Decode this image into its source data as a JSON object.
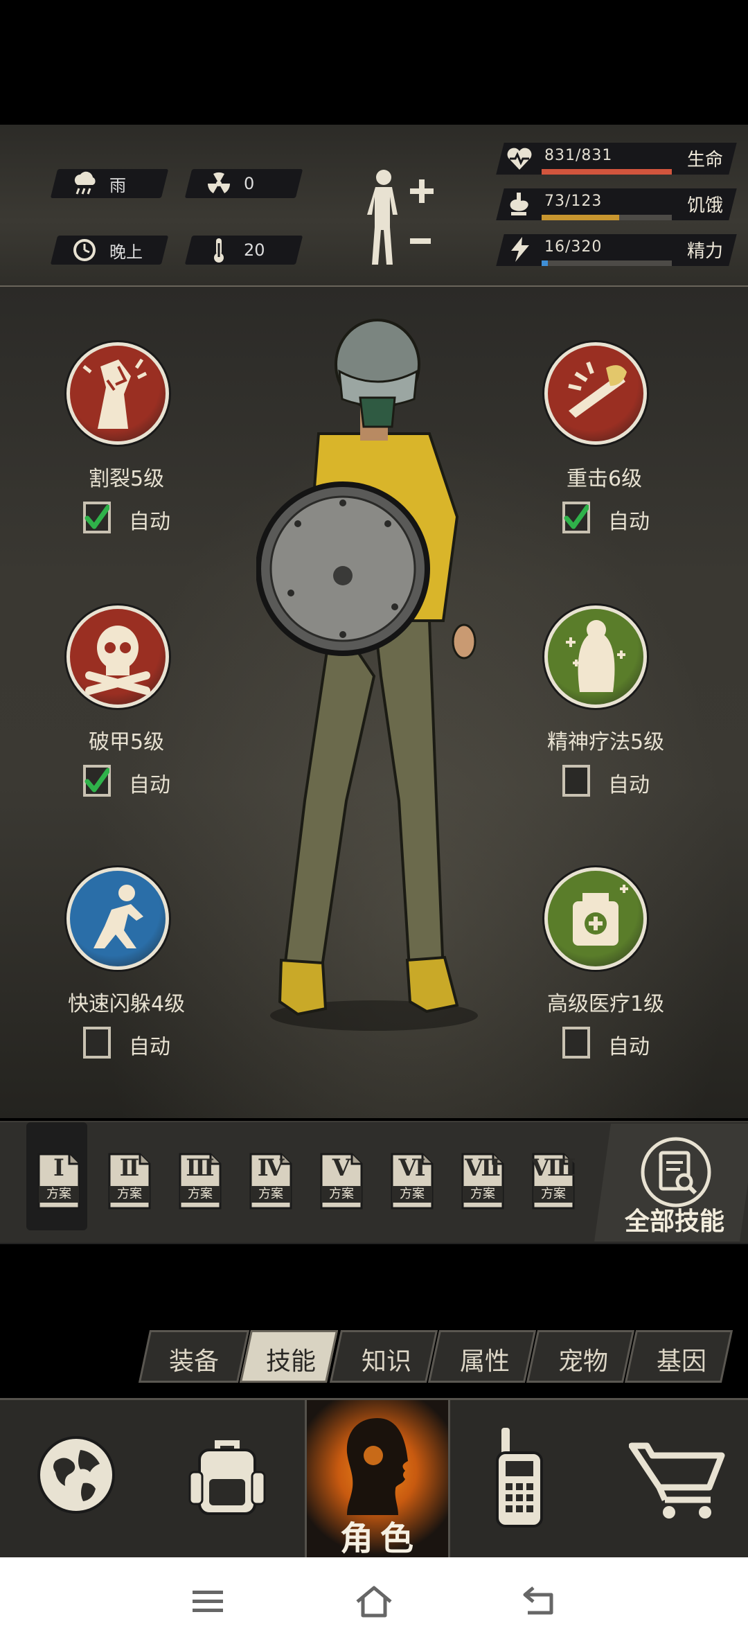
{
  "hud": {
    "weather": {
      "icon": "rain-cloud-icon",
      "label": "雨"
    },
    "radiation": {
      "icon": "radiation-icon",
      "value": "0"
    },
    "time_of_day": {
      "icon": "clock-icon",
      "label": "晚上"
    },
    "temperature": {
      "icon": "thermometer-icon",
      "value": "20"
    },
    "body_toggle": {
      "icon": "body-plus-minus-icon"
    },
    "stats": [
      {
        "key": "health",
        "icon": "heart-pulse-icon",
        "value": "831/831",
        "label": "生命",
        "fraction": 1.0,
        "color": "#d2553d"
      },
      {
        "key": "hunger",
        "icon": "stomach-icon",
        "value": "73/123",
        "label": "饥饿",
        "fraction": 0.5935,
        "color": "#c8962f"
      },
      {
        "key": "energy",
        "icon": "lightning-icon",
        "value": "16/320",
        "label": "精力",
        "fraction": 0.05,
        "color": "#3f8fd6"
      }
    ]
  },
  "skills": [
    {
      "id": "split",
      "name": "割裂5级",
      "icon": "crack-fist-icon",
      "bg": "#9a2f22",
      "auto": true
    },
    {
      "id": "heavy",
      "name": "重击6级",
      "icon": "axe-strike-icon",
      "bg": "#9a2f22",
      "auto": true
    },
    {
      "id": "armor-break",
      "name": "破甲5级",
      "icon": "skull-crossbones-icon",
      "bg": "#9a2f22",
      "auto": true
    },
    {
      "id": "mental",
      "name": "精神疗法5级",
      "icon": "spirit-heal-icon",
      "bg": "#5a7d2a",
      "auto": false
    },
    {
      "id": "dodge",
      "name": "快速闪躲4级",
      "icon": "crouch-dodge-icon",
      "bg": "#2a6ea8",
      "auto": false
    },
    {
      "id": "medical",
      "name": "高级医疗1级",
      "icon": "medkit-icon",
      "bg": "#5a7d2a",
      "auto": false
    }
  ],
  "auto_label": "自动",
  "plans": [
    {
      "numeral": "Ⅰ",
      "label": "方案",
      "selected": true
    },
    {
      "numeral": "Ⅱ",
      "label": "方案",
      "selected": false
    },
    {
      "numeral": "Ⅲ",
      "label": "方案",
      "selected": false
    },
    {
      "numeral": "Ⅳ",
      "label": "方案",
      "selected": false
    },
    {
      "numeral": "Ⅴ",
      "label": "方案",
      "selected": false
    },
    {
      "numeral": "Ⅵ",
      "label": "方案",
      "selected": false
    },
    {
      "numeral": "Ⅶ",
      "label": "方案",
      "selected": false
    },
    {
      "numeral": "Ⅷ",
      "label": "方案",
      "selected": false
    }
  ],
  "all_skills_label": "全部技能",
  "tabs": [
    {
      "label": "装备",
      "active": false
    },
    {
      "label": "技能",
      "active": true
    },
    {
      "label": "知识",
      "active": false
    },
    {
      "label": "属性",
      "active": false
    },
    {
      "label": "宠物",
      "active": false
    },
    {
      "label": "基因",
      "active": false
    }
  ],
  "nav": {
    "items": [
      {
        "icon": "globe-icon"
      },
      {
        "icon": "backpack-icon"
      },
      {
        "icon": "character-head-icon",
        "label": "角色",
        "active": true
      },
      {
        "icon": "walkie-talkie-icon"
      },
      {
        "icon": "shopping-cart-icon"
      }
    ]
  },
  "system_nav": {
    "icons": [
      "menu-icon",
      "home-icon",
      "back-icon"
    ]
  }
}
